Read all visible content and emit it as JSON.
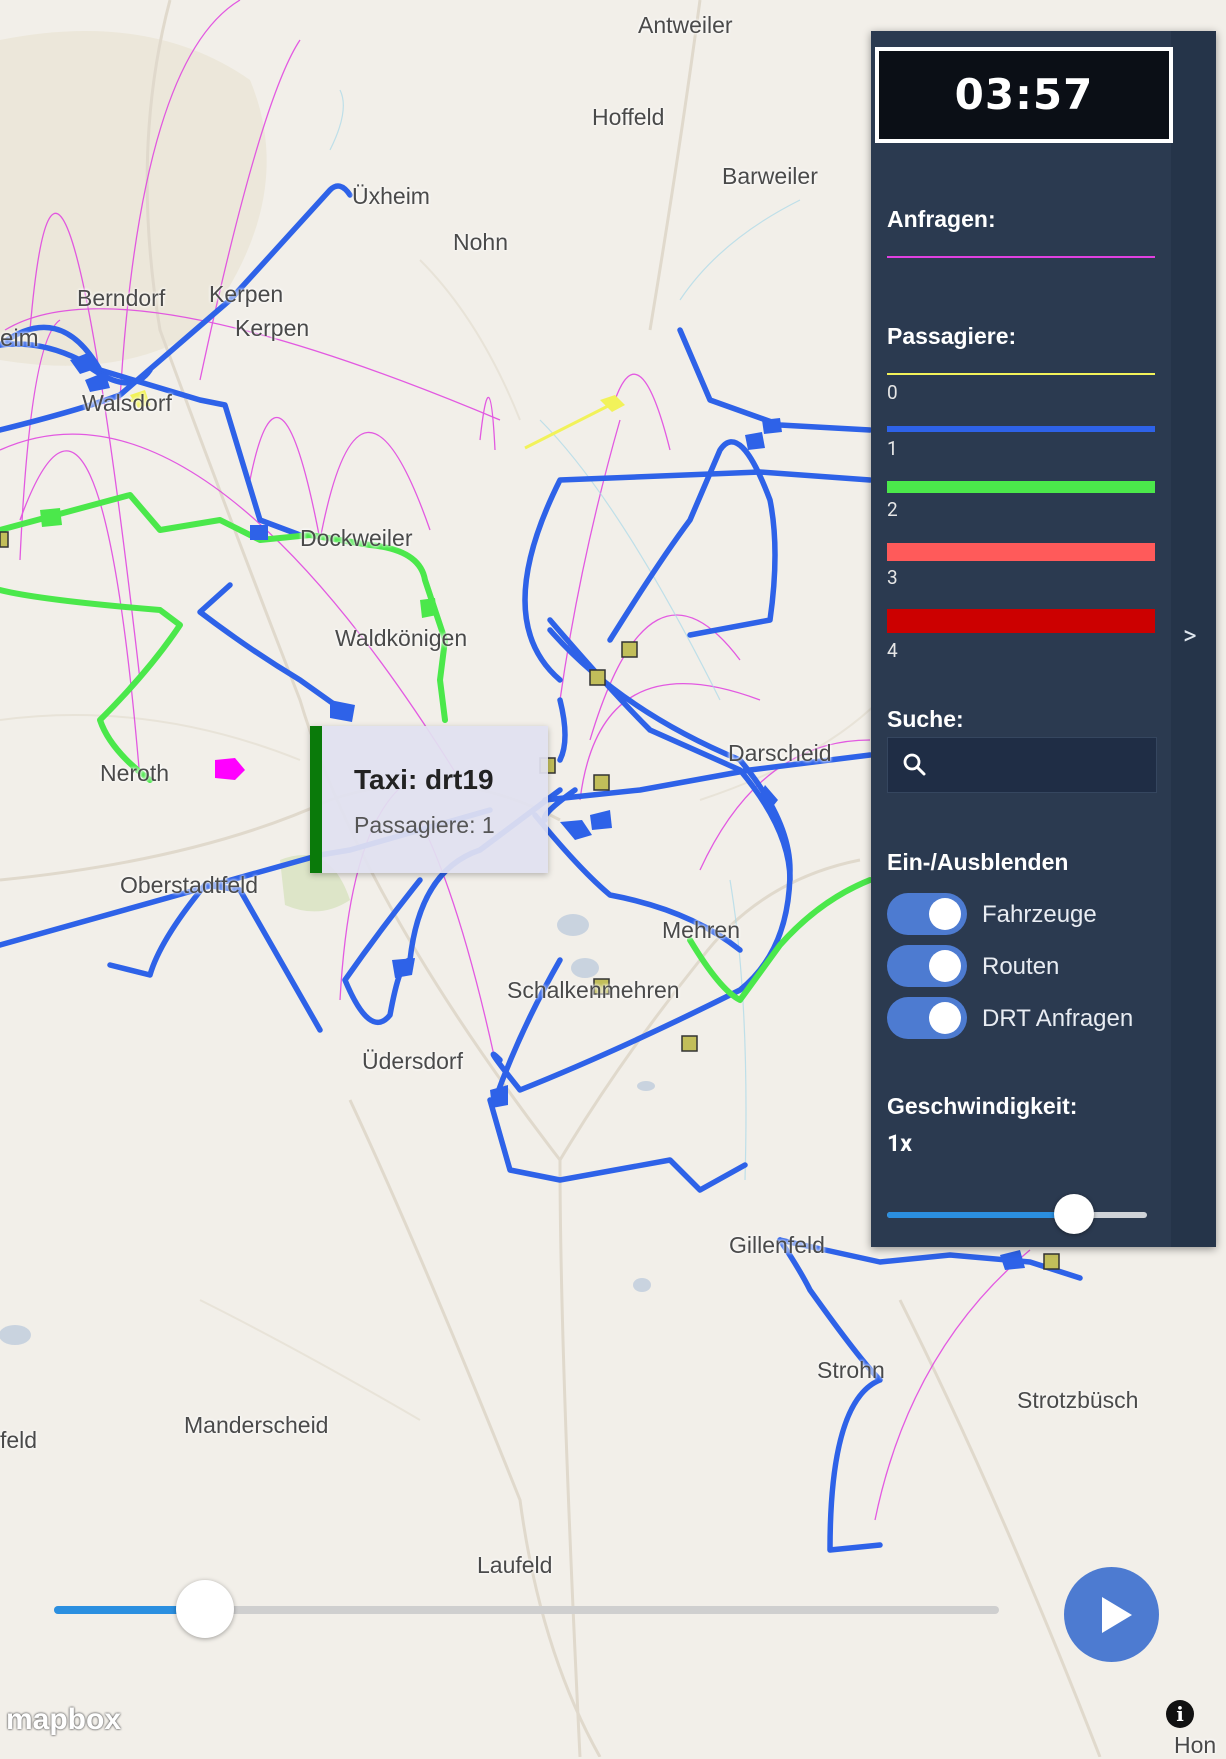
{
  "clock": "03:57",
  "panel": {
    "requests_title": "Anfragen:",
    "passengers_title": "Passagiere:",
    "passenger_legend": [
      {
        "label": "0",
        "color": "#f2f25a"
      },
      {
        "label": "1",
        "color": "#2e62e8"
      },
      {
        "label": "2",
        "color": "#4be84b"
      },
      {
        "label": "3",
        "color": "#ff5a5a"
      },
      {
        "label": "4",
        "color": "#cc0000"
      }
    ],
    "requests_color": "#e040e0",
    "search_title": "Suche:",
    "search_placeholder": "",
    "toggle_title": "Ein-/Ausblenden",
    "toggles": [
      {
        "label": "Fahrzeuge",
        "on": true
      },
      {
        "label": "Routen",
        "on": true
      },
      {
        "label": "DRT Anfragen",
        "on": true
      }
    ],
    "speed_title": "Geschwindigkeit:",
    "speed_value": "1x",
    "speed_fraction": 0.72,
    "collapse_label": ">"
  },
  "popup": {
    "title": "Taxi: drt19",
    "subtitle": "Passagiere: 1"
  },
  "timeline_fraction": 0.16,
  "attribution": {
    "logo": "mapbox",
    "info": "i"
  },
  "places": [
    "Antweiler",
    "Hoffeld",
    "Barweiler",
    "Üxheim",
    "Nohn",
    "Berndorf",
    "Kerpen",
    "Kerpen",
    "eim",
    "Walsdorf",
    "Dockweiler",
    "Waldkönigen",
    "Neroth",
    "Darscheid",
    "Oberstadtfeld",
    "Mehren",
    "Schalkenmehren",
    "Üdersdorf",
    "Gillenfeld",
    "Strohn",
    "Strotzbüsch",
    "feld",
    "Manderscheid",
    "Laufeld",
    "Hon"
  ]
}
